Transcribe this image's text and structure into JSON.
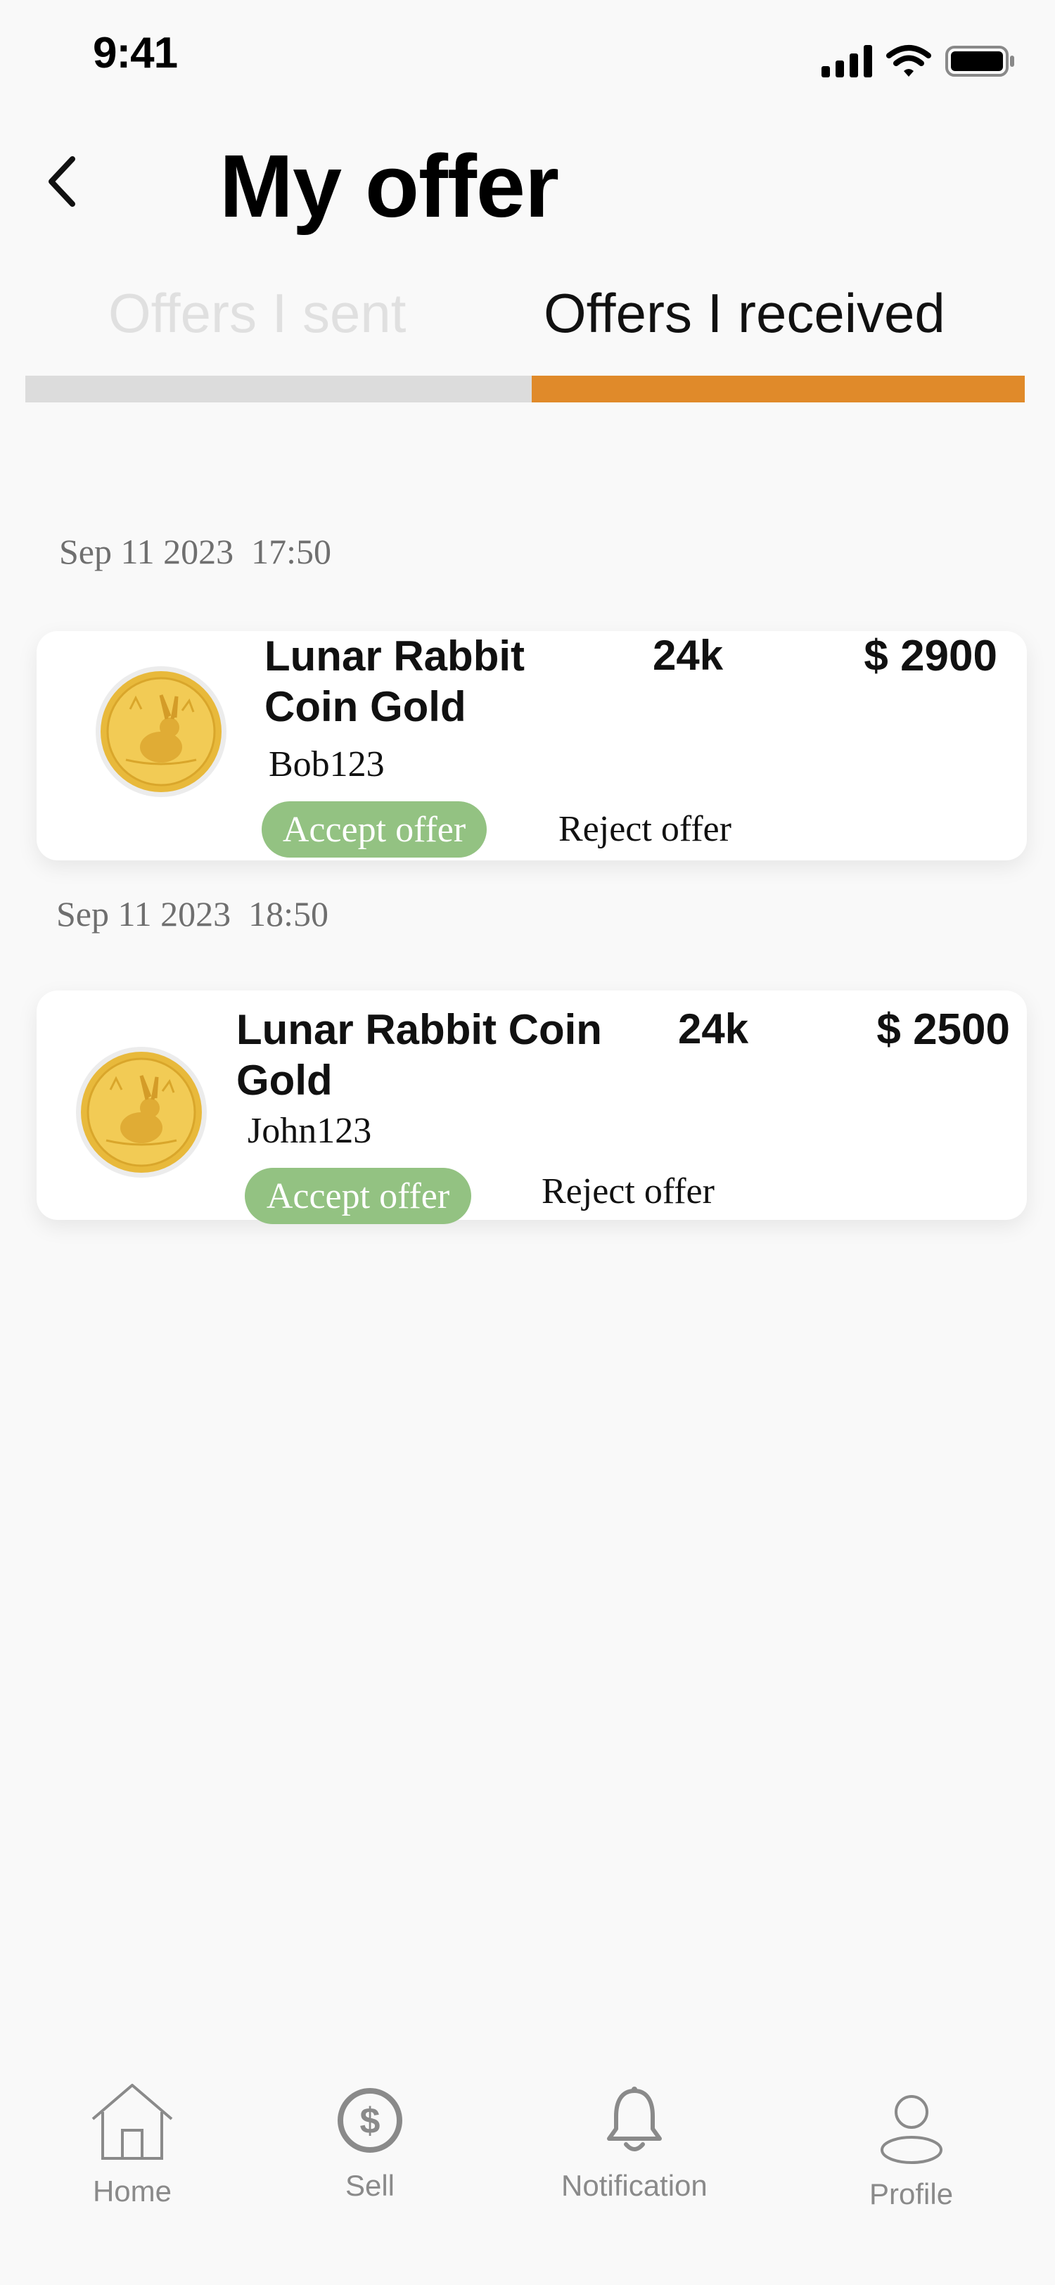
{
  "status_bar": {
    "time": "9:41"
  },
  "header": {
    "title": "My offer"
  },
  "tabs": [
    {
      "label": "Offers I sent",
      "active": false
    },
    {
      "label": "Offers I received",
      "active": true
    }
  ],
  "colors": {
    "accent": "#e08a2a",
    "tab_inactive_track": "#dcdcdc",
    "accept_button": "#93c282",
    "inactive_tab_text": "#e0e0e0",
    "gold": "#e8b93b"
  },
  "offers": [
    {
      "date": "Sep 11 2023  17:50",
      "product": "Lunar Rabbit Coin Gold",
      "product_line1": "Lunar Rabbit",
      "product_line2": "Coin Gold",
      "karat": "24k",
      "price": "$ 2900",
      "buyer": "Bob123",
      "accept_label": "Accept offer",
      "reject_label": "Reject offer",
      "image_icon": "gold-rabbit-coin"
    },
    {
      "date": "Sep 11 2023  18:50",
      "product": "Lunar Rabbit Coin Gold",
      "product_line1": "Lunar Rabbit Coin",
      "product_line2": "Gold",
      "karat": "24k",
      "price": "$ 2500",
      "buyer": "John123",
      "accept_label": "Accept offer",
      "reject_label": "Reject offer",
      "image_icon": "gold-rabbit-coin"
    }
  ],
  "bottom_nav": [
    {
      "label": "Home",
      "icon": "home-icon"
    },
    {
      "label": "Sell",
      "icon": "dollar-circle-icon"
    },
    {
      "label": "Notification",
      "icon": "bell-icon"
    },
    {
      "label": "Profile",
      "icon": "user-icon"
    }
  ]
}
